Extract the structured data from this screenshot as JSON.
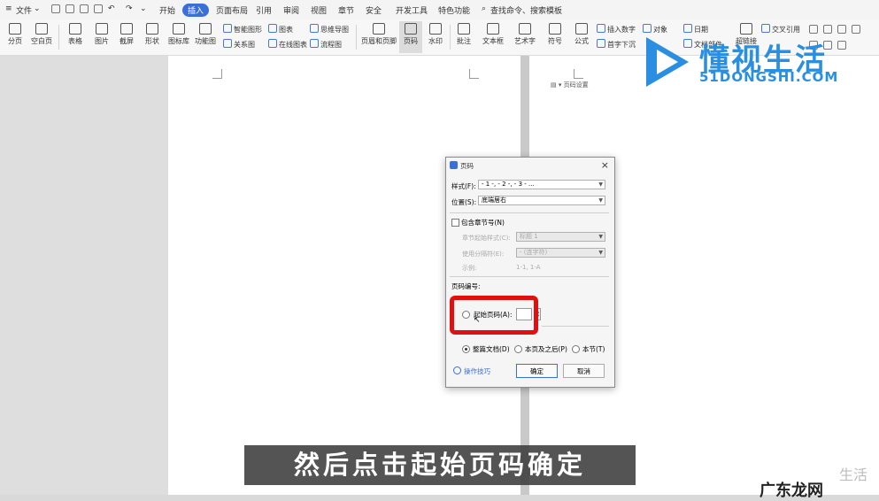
{
  "menubar": {
    "items": [
      "文件",
      "开始",
      "插入",
      "页面布局",
      "引用",
      "审阅",
      "视图",
      "章节",
      "安全",
      "开发工具",
      "特色功能"
    ],
    "active_tab": "插入",
    "search": "查找命令、搜索模板"
  },
  "ribbon": {
    "big_buttons": [
      "分页",
      "空白页",
      "表格",
      "图片",
      "截屏",
      "形状",
      "图标库",
      "功能图",
      "页眉和页脚",
      "页码",
      "水印",
      "批注",
      "文本框",
      "艺术字",
      "符号",
      "公式"
    ],
    "small_buttons": [
      "智能图形",
      "图表",
      "思维导图",
      "关系图",
      "在线图表",
      "流程图",
      "插入数字",
      "对象",
      "首字下沉",
      "日期",
      "文档部件",
      "超链接",
      "交叉引用"
    ]
  },
  "page2_hint": "页码设置",
  "logo": {
    "title": "懂视生活",
    "subtitle": "51DONGSHI.COM",
    "color": "#2a8fe0"
  },
  "dialog": {
    "title": "页码",
    "style_label": "样式(F):",
    "style_value": "- 1 -, - 2 -, - 3 - ...",
    "position_label": "位置(S):",
    "position_value": "底端居右",
    "include_chapter_label": "包含章节号(N)",
    "chapter_start_label": "章节起始样式(C):",
    "chapter_start_value": "标题 1",
    "separator_label": "使用分隔符(E):",
    "separator_value": "- (连字符)",
    "example_label": "示例:",
    "example_value": "1-1, 1-A",
    "numbering_label": "页码编号:",
    "start_page_label": "起始页码(A):",
    "apply_options": [
      "整篇文档(D)",
      "本页及之后(P)",
      "本节(T)"
    ],
    "tips": "操作技巧",
    "ok": "确定",
    "cancel": "取消"
  },
  "subtitle": "然后点击起始页码确定",
  "watermark": {
    "text": "广东龙网",
    "faint": "生活"
  }
}
